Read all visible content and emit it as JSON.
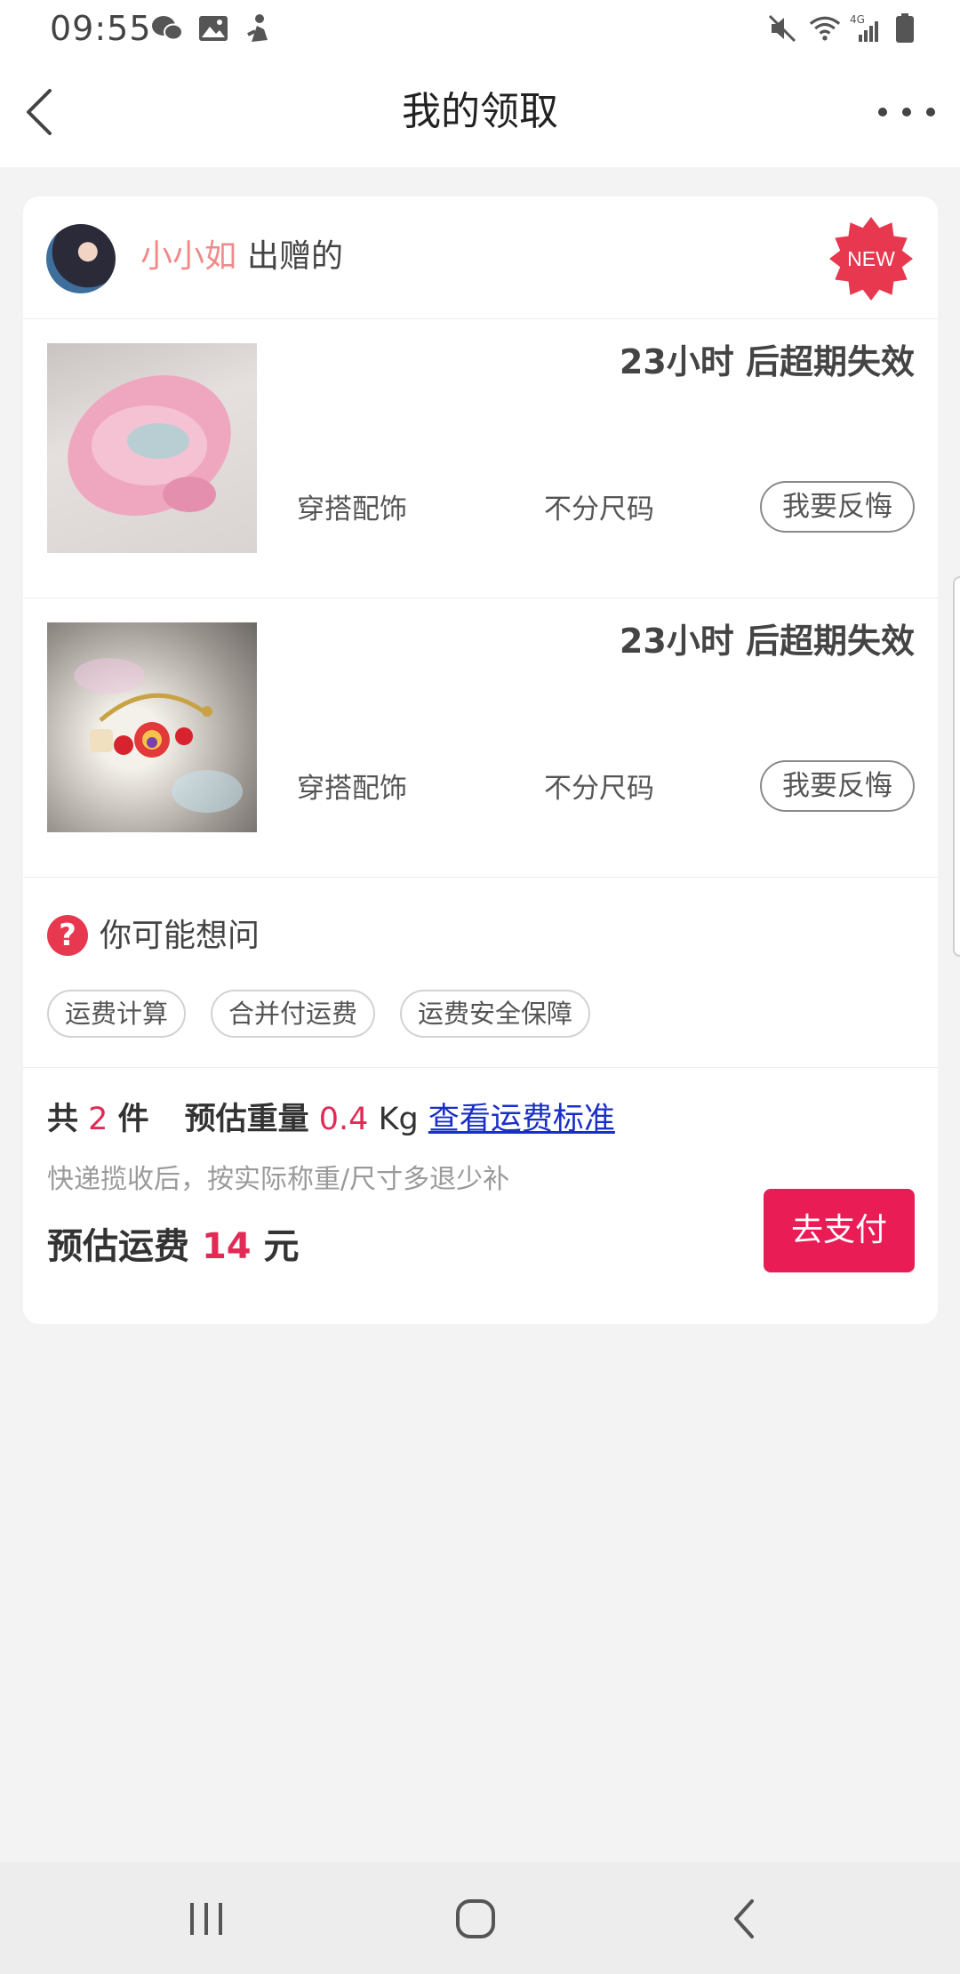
{
  "status_bar": {
    "time": "09:55",
    "left_icons": [
      "wechat-icon",
      "gallery-icon",
      "app-icon"
    ],
    "right_icons": [
      "mute-icon",
      "wifi-icon",
      "signal-4g-icon",
      "battery-icon"
    ],
    "network_label": "4G"
  },
  "header": {
    "title": "我的领取"
  },
  "donor": {
    "name": "小小如",
    "suffix": "出赠的",
    "badge": "NEW"
  },
  "items": [
    {
      "expire_text": "23小时 后超期失效",
      "category": "穿搭配饰",
      "size": "不分尺码",
      "regret_label": "我要反悔"
    },
    {
      "expire_text": "23小时 后超期失效",
      "category": "穿搭配饰",
      "size": "不分尺码",
      "regret_label": "我要反悔"
    }
  ],
  "faq": {
    "icon_text": "?",
    "title": "你可能想问",
    "chips": [
      "运费计算",
      "合并付运费",
      "运费安全保障"
    ]
  },
  "summary": {
    "count_prefix": "共",
    "count": "2",
    "count_unit": "件",
    "weight_label": "预估重量",
    "weight": "0.4",
    "weight_unit": "Kg",
    "fee_link": "查看运费标准",
    "note": "快递揽收后，按实际称重/尺寸多退少补",
    "fee_label": "预估运费",
    "fee": "14",
    "fee_unit": "元",
    "pay_label": "去支付"
  },
  "colors": {
    "accent": "#e91c55",
    "price_red": "#e22a56",
    "donor_name": "#f08a8a",
    "link": "#1a2ec8",
    "background": "#f3f3f3"
  }
}
